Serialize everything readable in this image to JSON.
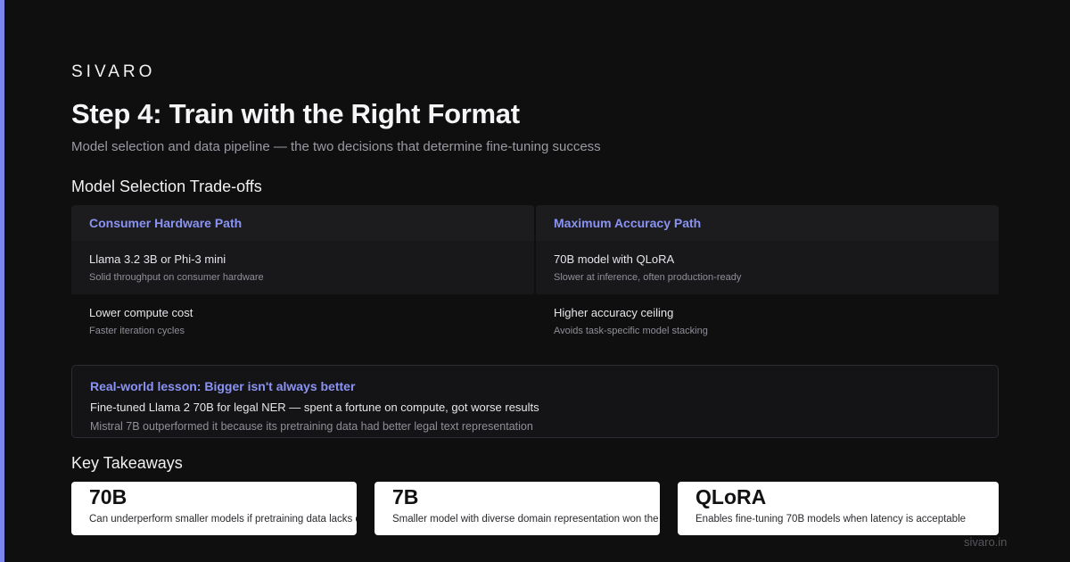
{
  "brand": "SIVARO",
  "title": "Step 4: Train with the Right Format",
  "subtitle": "Model selection and data pipeline — the two decisions that determine fine-tuning success",
  "tradeoffs": {
    "heading": "Model Selection Trade-offs",
    "left": {
      "header": "Consumer Hardware Path",
      "rows": [
        {
          "main": "Llama 3.2 3B or Phi-3 mini",
          "sub": "Solid throughput on consumer hardware"
        },
        {
          "main": "Lower compute cost",
          "sub": "Faster iteration cycles"
        }
      ]
    },
    "right": {
      "header": "Maximum Accuracy Path",
      "rows": [
        {
          "main": "70B model with QLoRA",
          "sub": "Slower at inference, often production-ready"
        },
        {
          "main": "Higher accuracy ceiling",
          "sub": "Avoids task-specific model stacking"
        }
      ]
    }
  },
  "lesson": {
    "title": "Real-world lesson: Bigger isn't always better",
    "line1": "Fine-tuned Llama 2 70B for legal NER — spent a fortune on compute, got worse results",
    "line2": "Mistral 7B outperformed it because its pretraining data had better legal text representation"
  },
  "takeaways": {
    "heading": "Key Takeaways",
    "cards": [
      {
        "value": "70B",
        "desc": "Can underperform smaller models if pretraining data lacks domain coverage"
      },
      {
        "value": "7B",
        "desc": "Smaller model with diverse domain representation won the legal NER task"
      },
      {
        "value": "QLoRA",
        "desc": "Enables fine-tuning 70B models when latency is acceptable"
      }
    ]
  },
  "footer": "sivaro.in",
  "colors": {
    "background": "#0f0f10",
    "accent": "#7c86ee",
    "card": "#ffffff"
  }
}
